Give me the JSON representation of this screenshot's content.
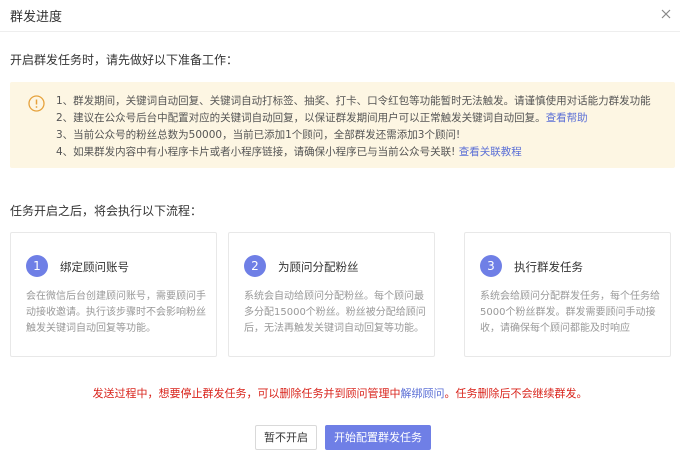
{
  "dialog": {
    "title": "群发进度"
  },
  "intro": "开启群发任务时，请先做好以下准备工作：",
  "notice": {
    "items": [
      {
        "text": "1、群发期间，关键词自动回复、关键词自动打标签、抽奖、打卡、口令红包等功能暂时无法触发。请谨慎使用对话能力群发功能",
        "link": ""
      },
      {
        "text": "2、建议在公众号后台中配置对应的关键词自动回复，以保证群发期间用户可以正常触发关键词自动回复。",
        "link": "查看帮助"
      },
      {
        "text": "3、当前公众号的粉丝总数为50000，当前已添加1个顾问，全部群发还需添加3个顾问!",
        "link": ""
      },
      {
        "text": "4、如果群发内容中有小程序卡片或者小程序链接，请确保小程序已与当前公众号关联! ",
        "link": "查看关联教程"
      }
    ]
  },
  "flow_title": "任务开启之后，将会执行以下流程：",
  "steps": [
    {
      "num": "1",
      "title": "绑定顾问账号",
      "desc": "会在微信后台创建顾问账号，需要顾问手动接收邀请。执行该步骤时不会影响粉丝触发关键词自动回复等功能。"
    },
    {
      "num": "2",
      "title": "为顾问分配粉丝",
      "desc": "系统会自动给顾问分配粉丝。每个顾问最多分配15000个粉丝。粉丝被分配给顾问后，无法再触发关键词自动回复等功能。"
    },
    {
      "num": "3",
      "title": "执行群发任务",
      "desc": "系统会给顾问分配群发任务，每个任务给5000个粉丝群发。群发需要顾问手动接收，请确保每个顾问都能及时响应"
    }
  ],
  "footer": {
    "note_before": "发送过程中，想要停止群发任务，可以删除任务并到顾问管理中",
    "note_link": "解绑顾问",
    "note_after": "。任务删除后不会继续群发。"
  },
  "buttons": {
    "cancel": "暂不开启",
    "start": "开始配置群发任务"
  },
  "colors": {
    "accent": "#6f7fe6",
    "warning_bg": "#fdf6e3",
    "warning_icon": "#e6a23c",
    "danger": "#d9241c",
    "link": "#5b6fd6"
  },
  "icons": {
    "close": "close-icon",
    "warning": "warning-icon"
  }
}
